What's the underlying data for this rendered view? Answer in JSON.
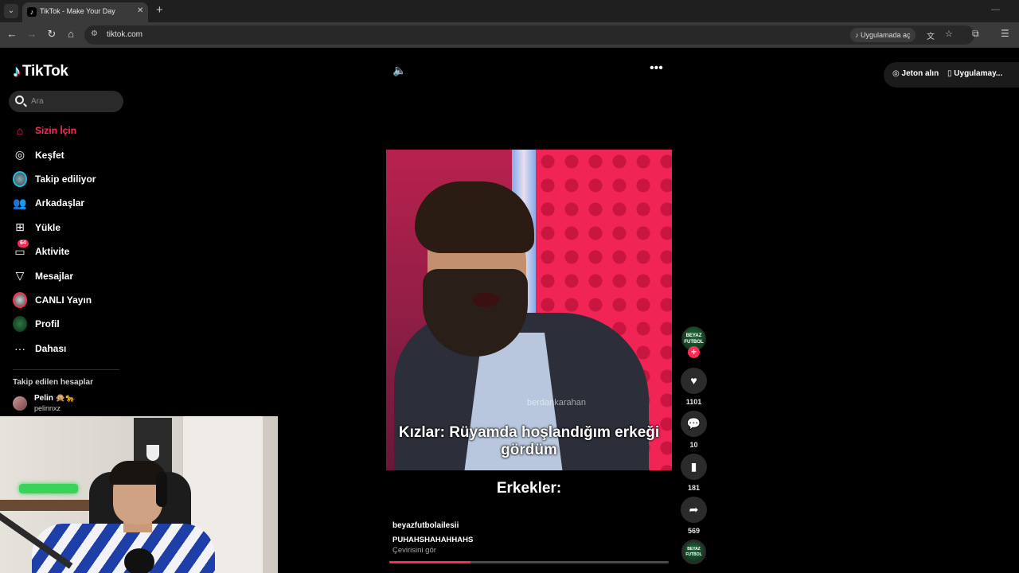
{
  "browser": {
    "tab_title": "TikTok - Make Your Day",
    "url": "tiktok.com",
    "open_in_app": "Uygulamada aç"
  },
  "sidebar": {
    "logo": "TikTok",
    "search_placeholder": "Ara",
    "items": [
      {
        "label": "Sizin İçin",
        "icon": "home-icon",
        "active": true
      },
      {
        "label": "Keşfet",
        "icon": "compass-icon"
      },
      {
        "label": "Takip ediliyor",
        "icon": "following-avatar-icon"
      },
      {
        "label": "Arkadaşlar",
        "icon": "friends-icon"
      },
      {
        "label": "Yükle",
        "icon": "upload-icon"
      },
      {
        "label": "Aktivite",
        "icon": "activity-icon",
        "badge": "64"
      },
      {
        "label": "Mesajlar",
        "icon": "send-icon"
      },
      {
        "label": "CANLI Yayın",
        "icon": "live-avatar-icon"
      },
      {
        "label": "Profil",
        "icon": "profile-avatar-icon"
      },
      {
        "label": "Dahası",
        "icon": "more-dots-icon"
      }
    ],
    "followed_title": "Takip edilen hesaplar",
    "followed_users": [
      {
        "name": "Pelin 🙊🐆",
        "handle": "pelinnxz"
      }
    ]
  },
  "video": {
    "watermark": "berdankarahan",
    "caption": "Kızlar: Rüyamda hoşlandığım erkeği gördüm",
    "under_caption": "Erkekler:",
    "author": "beyazfutbolailesii",
    "description": "PUHAHSHAHAHHAHS",
    "translate": "Çevirisini gör",
    "progress": 0.29
  },
  "actions": {
    "creator_avatar_text": "BEYAZ FUTBOL",
    "likes": "1101",
    "comments": "10",
    "saves": "181",
    "shares": "569"
  },
  "top_actions": {
    "coins": "Jeton alın",
    "get_app": "Uygulamay..."
  },
  "colors": {
    "accent": "#fe2c55",
    "background": "#000000"
  }
}
